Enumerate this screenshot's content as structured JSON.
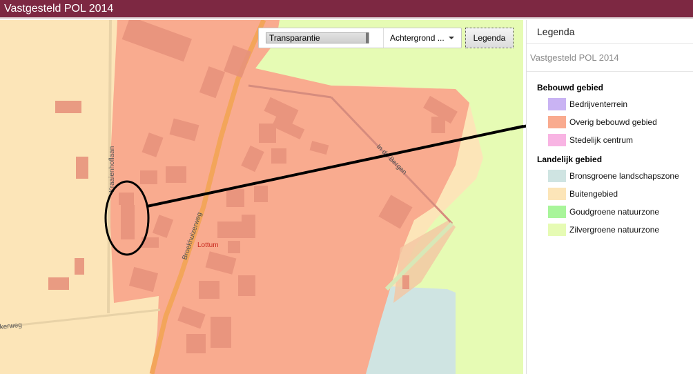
{
  "titlebar": {
    "title": "Vastgesteld POL 2014"
  },
  "map": {
    "labels": {
      "kraaienhoflaan": "Kraaienhoflaan",
      "broekhuizerweg": "Broekhuizerweg",
      "lottum": "Lottum",
      "in_de_bergen": "In de Bergen",
      "kerweg": "kerweg"
    },
    "colors": {
      "buitengebied": "#fce5b8",
      "bebouwd": "#f9ab8f",
      "zilvergroen": "#e6fbb4",
      "bronsgroen": "#cfe4e2",
      "road": "#f3a55a",
      "building": "#e7927c",
      "annotation": "#000000",
      "place_label": "#c8281e"
    }
  },
  "controls": {
    "transparency_label": "Transparantie",
    "background_label": "Achtergrond ...",
    "legend_button": "Legenda"
  },
  "legend": {
    "title": "Legenda",
    "subtitle": "Vastgesteld POL 2014",
    "groups": [
      {
        "title": "Bebouwd gebied",
        "items": [
          {
            "label": "Bedrijventerrein",
            "color": "#c9b3f3"
          },
          {
            "label": "Overig bebouwd gebied",
            "color": "#f9ab8f"
          },
          {
            "label": "Stedelijk centrum",
            "color": "#f8b4e3"
          }
        ]
      },
      {
        "title": "Landelijk gebied",
        "items": [
          {
            "label": "Bronsgroene landschapszone",
            "color": "#cfe4e2"
          },
          {
            "label": "Buitengebied",
            "color": "#fce5b8"
          },
          {
            "label": "Goudgroene natuurzone",
            "color": "#a8f59a"
          },
          {
            "label": "Zilvergroene natuurzone",
            "color": "#e6fbb4"
          }
        ]
      }
    ]
  }
}
